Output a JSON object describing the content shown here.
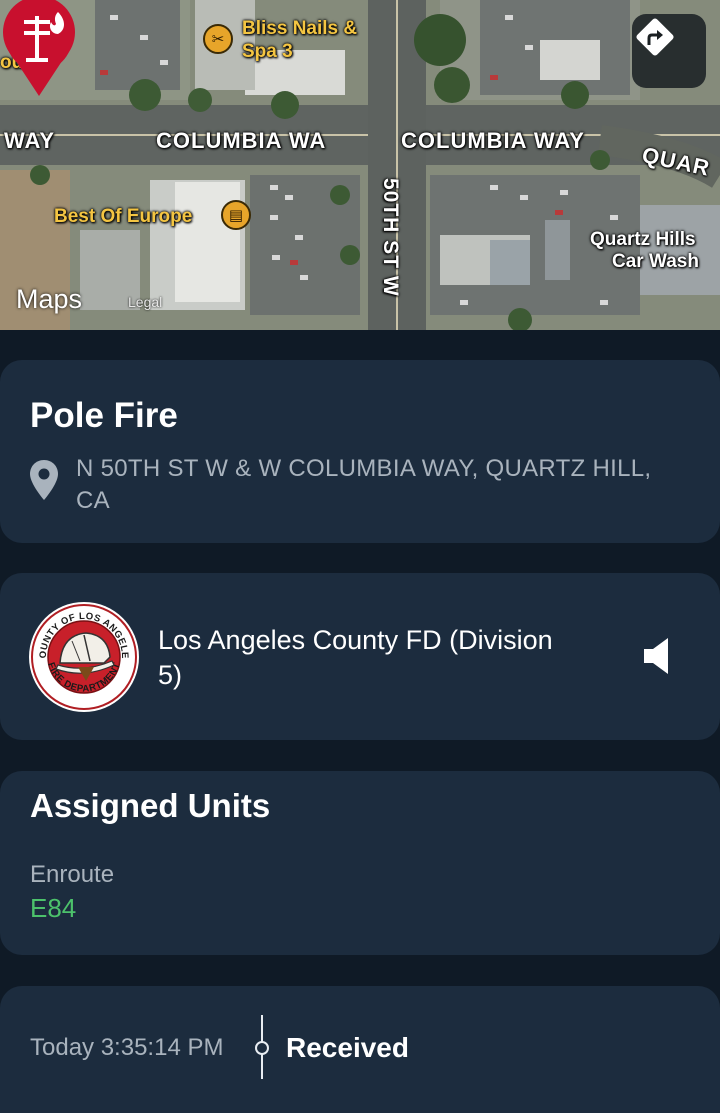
{
  "map": {
    "streets": {
      "way_left": "WAY",
      "columbia_left": "COLUMBIA WA",
      "columbia_right": "COLUMBIA WAY",
      "quartz": "QUAR",
      "fiftieth": "50TH ST W"
    },
    "pois": {
      "cut_off": "our",
      "bliss_line1": "Bliss Nails &",
      "bliss_line2": "Spa 3",
      "best_of_europe": "Best Of Europe",
      "car_wash_line1": "Quartz Hills",
      "car_wash_line2": "Car Wash"
    },
    "brand": "Maps",
    "legal": "Legal",
    "pin_icon": "pole-fire-icon",
    "pin_color": "#c8102e",
    "directions_icon": "directions-icon"
  },
  "incident": {
    "title": "Pole Fire",
    "location_icon": "location-pin-icon",
    "location": "N 50TH ST W & W COLUMBIA WAY, QUARTZ HILL, CA"
  },
  "agency": {
    "logo_icon": "fire-department-seal-icon",
    "logo_ring_top": "COUNTY OF LOS ANGELES",
    "logo_ring_bottom": "FIRE DEPARTMENT",
    "name": "Los Angeles County FD (Division 5)",
    "audio_icon": "speaker-icon"
  },
  "units": {
    "title": "Assigned Units",
    "groups": [
      {
        "status": "Enroute",
        "unit": "E84",
        "status_color": "#4cc26b"
      }
    ]
  },
  "timeline": {
    "events": [
      {
        "time": "Today 3:35:14 PM",
        "label": "Received"
      }
    ]
  },
  "colors": {
    "background": "#0f1a26",
    "card": "#1c2c3e",
    "muted_text": "#a9b3bd",
    "unit_green": "#4cc26b",
    "pin_red": "#c8102e"
  }
}
